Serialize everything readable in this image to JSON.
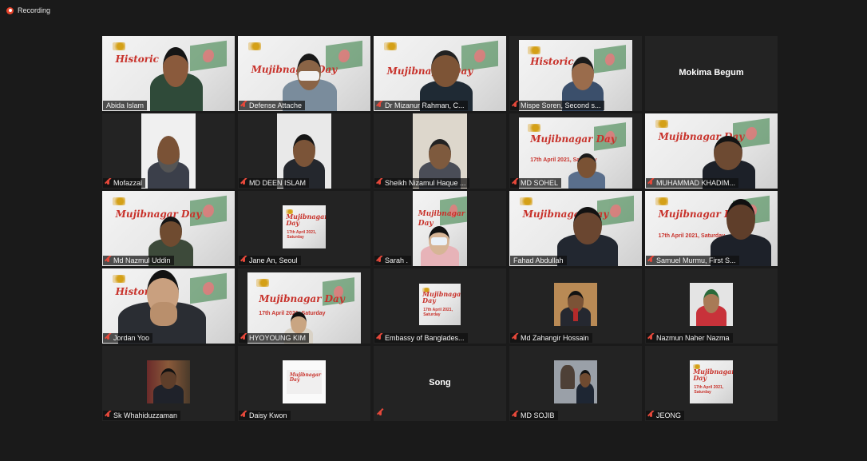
{
  "recording": {
    "label": "Recording"
  },
  "colors": {
    "background": "#1a1a1a",
    "tile": "#232323",
    "active_speaker_border": "#b9d84a",
    "muted_icon": "#e5483a",
    "recording_icon": "#e8452c"
  },
  "slide": {
    "title_line1": "Historic",
    "title_line2": "Mujibnagar Day",
    "date": "17th April 2021, Saturday"
  },
  "participants": [
    {
      "name": "Abida Islam",
      "muted": false,
      "view": "slide-person",
      "speaking": true
    },
    {
      "name": "Defense Attache",
      "muted": true,
      "view": "slide-person"
    },
    {
      "name": "Dr Mizanur Rahman, C...",
      "muted": true,
      "view": "slide-person"
    },
    {
      "name": "Mispe Soren, Second s...",
      "muted": true,
      "view": "slide-person"
    },
    {
      "name": "Mokima Begum",
      "muted": false,
      "view": "name-only"
    },
    {
      "name": "Mofazzal",
      "muted": true,
      "view": "portrait"
    },
    {
      "name": "MD DEEN ISLAM",
      "muted": true,
      "view": "portrait"
    },
    {
      "name": "Sheikh Nizamul Haque ...",
      "muted": true,
      "view": "portrait"
    },
    {
      "name": "MD SOHEL",
      "muted": true,
      "view": "slide-person"
    },
    {
      "name": "MUHAMMAD KHADIM...",
      "muted": true,
      "view": "slide-person"
    },
    {
      "name": "Md Nazmul Uddin",
      "muted": true,
      "view": "slide-person"
    },
    {
      "name": "Jane An, Seoul",
      "muted": true,
      "view": "slide-small"
    },
    {
      "name": "Sarah .",
      "muted": true,
      "view": "portrait-slide"
    },
    {
      "name": "Fahad Abdullah",
      "muted": false,
      "view": "slide-person"
    },
    {
      "name": "Samuel Murmu, First S...",
      "muted": true,
      "view": "slide-person"
    },
    {
      "name": "Jordan Yoo",
      "muted": true,
      "view": "slide-person"
    },
    {
      "name": "HYOYOUNG KIM",
      "muted": true,
      "view": "slide-person"
    },
    {
      "name": "Embassy of Banglades...",
      "muted": true,
      "view": "slide-tiny"
    },
    {
      "name": "Md Zahangir Hossain",
      "muted": true,
      "view": "small-photo"
    },
    {
      "name": "Nazmun Naher Nazma",
      "muted": true,
      "view": "small-photo"
    },
    {
      "name": "Sk Whahiduzzaman",
      "muted": true,
      "view": "small-photo"
    },
    {
      "name": "Daisy Kwon",
      "muted": true,
      "view": "slide-tiny"
    },
    {
      "name": "Song",
      "muted": true,
      "view": "name-only"
    },
    {
      "name": "MD SOJIB",
      "muted": true,
      "view": "small-photo"
    },
    {
      "name": "JEONG",
      "muted": true,
      "view": "slide-tiny"
    }
  ]
}
